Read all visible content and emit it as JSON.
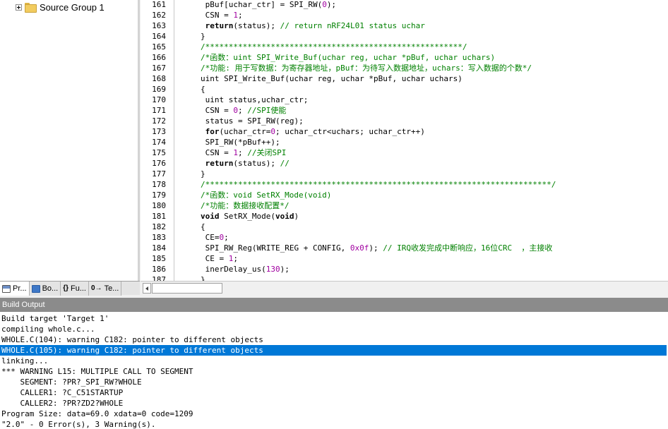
{
  "project": {
    "tree": [
      {
        "label": "Source Group 1",
        "icon": "folder-icon",
        "expander": "plus"
      }
    ],
    "tabs": [
      {
        "label": "Pr...",
        "icon": "project-icon",
        "active": true
      },
      {
        "label": "Bo...",
        "icon": "books-icon",
        "active": false
      },
      {
        "label": "Fu...",
        "icon": "functions-icon",
        "icon_glyph": "{}",
        "active": false
      },
      {
        "label": "Te...",
        "icon": "templates-icon",
        "icon_glyph": "0→",
        "active": false
      }
    ]
  },
  "editor": {
    "lines": [
      {
        "n": "161",
        "tokens": [
          [
            "p",
            " pBuf[uchar_ctr] = SPI_RW("
          ],
          [
            "n",
            "0"
          ],
          [
            "p",
            ");"
          ]
        ]
      },
      {
        "n": "162",
        "tokens": [
          [
            "p",
            " CSN = "
          ],
          [
            "n",
            "1"
          ],
          [
            "p",
            ";"
          ]
        ]
      },
      {
        "n": "163",
        "tokens": [
          [
            "p",
            " "
          ],
          [
            "k",
            "return"
          ],
          [
            "p",
            "(status); "
          ],
          [
            "c",
            "// return nRF24L01 status uchar"
          ]
        ]
      },
      {
        "n": "164",
        "tokens": [
          [
            "p",
            "}"
          ]
        ]
      },
      {
        "n": "165",
        "tokens": [
          [
            "c",
            "/*******************************************************/"
          ]
        ]
      },
      {
        "n": "166",
        "tokens": [
          [
            "c",
            "/*函数：uint SPI_Write_Buf(uchar reg, uchar *pBuf, uchar uchars)"
          ]
        ]
      },
      {
        "n": "167",
        "tokens": [
          [
            "c",
            "/*功能: 用于写数据：为寄存器地址，pBuf：为待写入数据地址，uchars：写入数据的个数*/"
          ]
        ]
      },
      {
        "n": "168",
        "tokens": [
          [
            "p",
            "uint SPI_Write_Buf(uchar reg, uchar *pBuf, uchar uchars)"
          ]
        ]
      },
      {
        "n": "169",
        "tokens": [
          [
            "p",
            "{"
          ]
        ]
      },
      {
        "n": "170",
        "tokens": [
          [
            "p",
            " uint status,uchar_ctr;"
          ]
        ]
      },
      {
        "n": "171",
        "tokens": [
          [
            "p",
            " CSN = "
          ],
          [
            "n",
            "0"
          ],
          [
            "p",
            "; "
          ],
          [
            "c",
            "//SPI使能"
          ]
        ]
      },
      {
        "n": "172",
        "tokens": [
          [
            "p",
            " status = SPI_RW(reg);"
          ]
        ]
      },
      {
        "n": "173",
        "tokens": [
          [
            "p",
            " "
          ],
          [
            "k",
            "for"
          ],
          [
            "p",
            "(uchar_ctr="
          ],
          [
            "n",
            "0"
          ],
          [
            "p",
            "; uchar_ctr<uchars; uchar_ctr++)"
          ]
        ]
      },
      {
        "n": "174",
        "tokens": [
          [
            "p",
            " SPI_RW(*pBuf++);"
          ]
        ]
      },
      {
        "n": "175",
        "tokens": [
          [
            "p",
            " CSN = "
          ],
          [
            "n",
            "1"
          ],
          [
            "p",
            "; "
          ],
          [
            "c",
            "//关闭SPI"
          ]
        ]
      },
      {
        "n": "176",
        "tokens": [
          [
            "p",
            " "
          ],
          [
            "k",
            "return"
          ],
          [
            "p",
            "(status); "
          ],
          [
            "c",
            "//"
          ]
        ]
      },
      {
        "n": "177",
        "tokens": [
          [
            "p",
            "}"
          ]
        ]
      },
      {
        "n": "178",
        "tokens": [
          [
            "c",
            "/**************************************************************************/"
          ]
        ]
      },
      {
        "n": "179",
        "tokens": [
          [
            "c",
            "/*函数：void SetRX_Mode(void)"
          ]
        ]
      },
      {
        "n": "180",
        "tokens": [
          [
            "c",
            "/*功能：数据接收配置*/"
          ]
        ]
      },
      {
        "n": "181",
        "tokens": [
          [
            "k",
            "void"
          ],
          [
            "p",
            " SetRX_Mode("
          ],
          [
            "k",
            "void"
          ],
          [
            "p",
            ")"
          ]
        ]
      },
      {
        "n": "182",
        "tokens": [
          [
            "p",
            "{"
          ]
        ]
      },
      {
        "n": "183",
        "tokens": [
          [
            "p",
            " CE="
          ],
          [
            "n",
            "0"
          ],
          [
            "p",
            ";"
          ]
        ]
      },
      {
        "n": "184",
        "tokens": [
          [
            "p",
            " SPI_RW_Reg(WRITE_REG + CONFIG, "
          ],
          [
            "n",
            "0x0f"
          ],
          [
            "p",
            "); "
          ],
          [
            "c",
            "// IRQ收发完成中断响应，16位CRC  ，主接收"
          ]
        ]
      },
      {
        "n": "185",
        "tokens": [
          [
            "p",
            " CE = "
          ],
          [
            "n",
            "1"
          ],
          [
            "p",
            ";"
          ]
        ]
      },
      {
        "n": "186",
        "tokens": [
          [
            "p",
            " inerDelay_us("
          ],
          [
            "n",
            "130"
          ],
          [
            "p",
            ");"
          ]
        ]
      },
      {
        "n": "187",
        "tokens": [
          [
            "p",
            "}"
          ]
        ]
      }
    ]
  },
  "build_output": {
    "title": "Build Output",
    "lines": [
      {
        "text": "Build target 'Target 1'",
        "selected": false
      },
      {
        "text": "compiling whole.c...",
        "selected": false
      },
      {
        "text": "WHOLE.C(104): warning C182: pointer to different objects",
        "selected": false
      },
      {
        "text": "WHOLE.C(105): warning C182: pointer to different objects",
        "selected": true
      },
      {
        "text": "linking...",
        "selected": false
      },
      {
        "text": "*** WARNING L15: MULTIPLE CALL TO SEGMENT",
        "selected": false
      },
      {
        "text": "    SEGMENT: ?PR?_SPI_RW?WHOLE",
        "selected": false
      },
      {
        "text": "    CALLER1: ?C_C51STARTUP",
        "selected": false
      },
      {
        "text": "    CALLER2: ?PR?ZD2?WHOLE",
        "selected": false
      },
      {
        "text": "Program Size: data=69.0 xdata=0 code=1209",
        "selected": false
      },
      {
        "text": "\"2.0\" - 0 Error(s), 3 Warning(s).",
        "selected": false
      }
    ]
  },
  "colors": {
    "comment": "#008000",
    "number": "#a000a0",
    "selection": "#0078d7",
    "build_header": "#8b8b8b"
  }
}
